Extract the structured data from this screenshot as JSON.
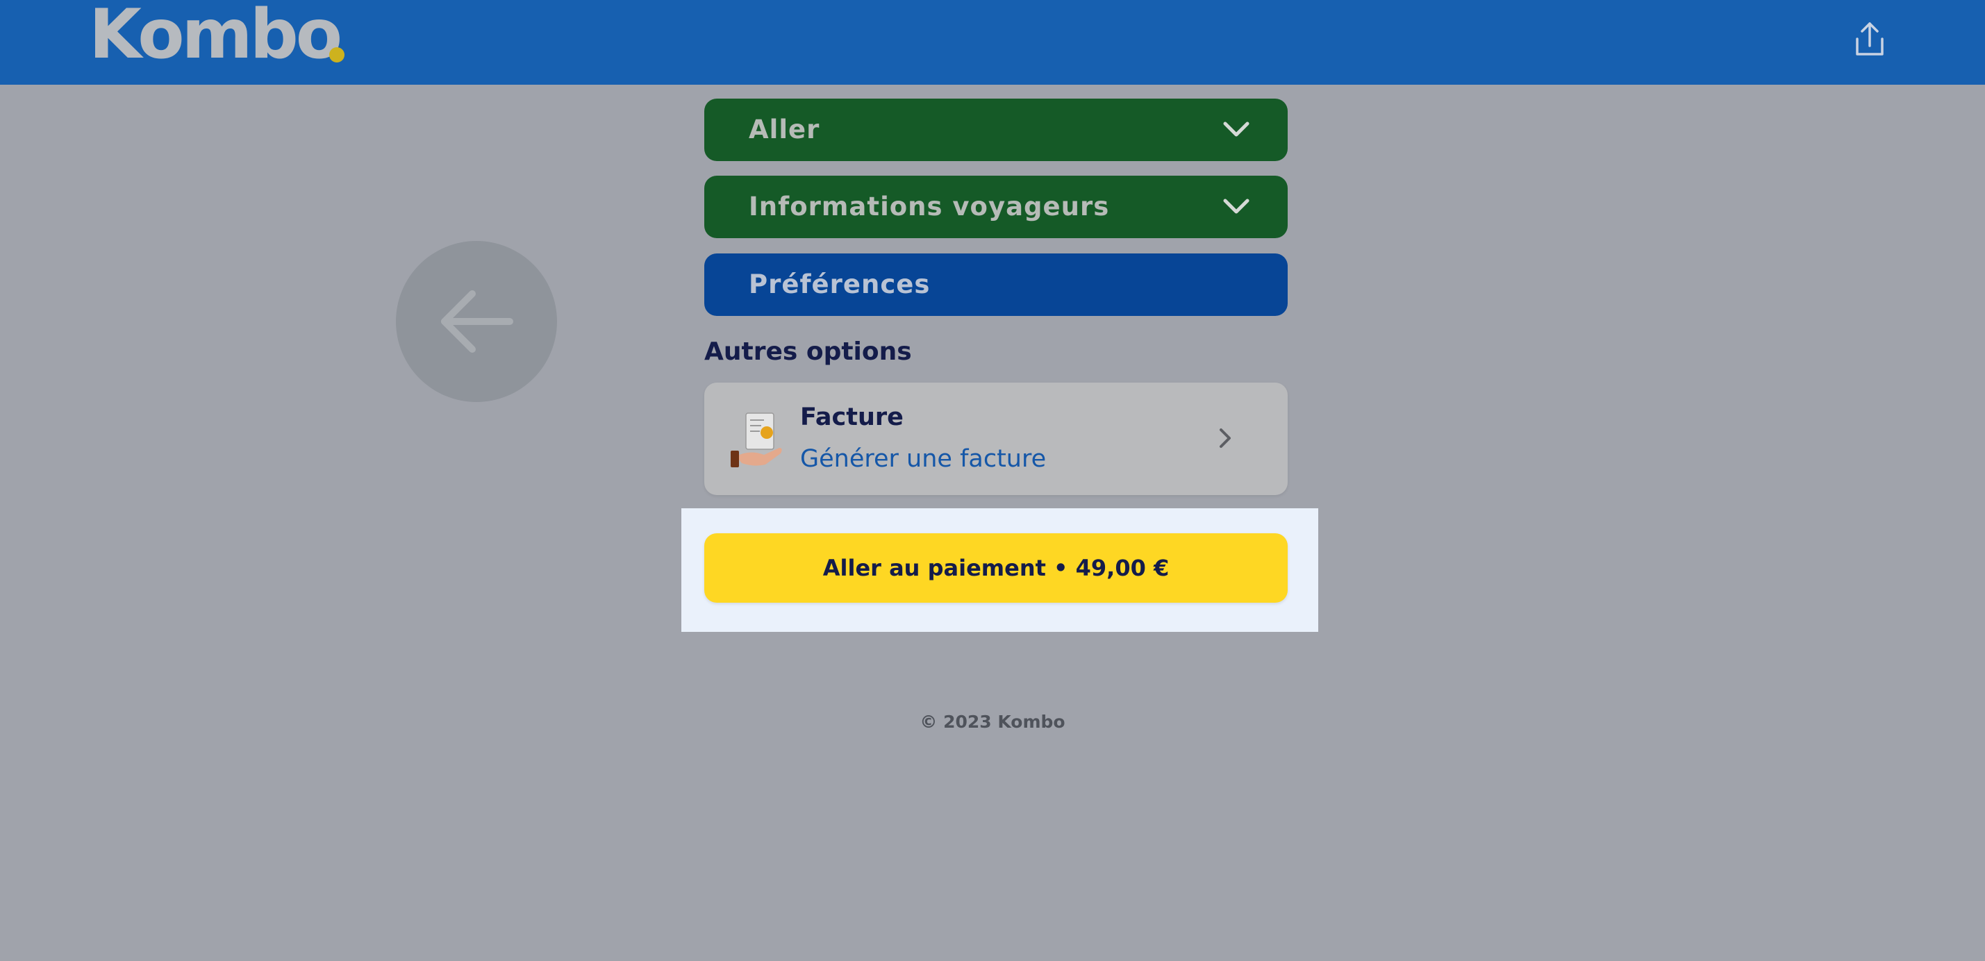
{
  "header": {
    "logo_text": "Kombo",
    "share_icon": "share-upload-icon",
    "background_color": "#1760b0"
  },
  "back_button": {
    "icon": "arrow-left-icon"
  },
  "sections": [
    {
      "label": "Aller",
      "icon": "chevron-down-icon",
      "color": "#155a27"
    },
    {
      "label": "Informations voyageurs",
      "icon": "chevron-down-icon",
      "color": "#155a27"
    },
    {
      "label": "Préférences",
      "color": "#074596"
    }
  ],
  "autres_options": {
    "heading": "Autres options",
    "facture": {
      "title": "Facture",
      "subtitle": "Générer une facture",
      "icon": "invoice-hand-icon",
      "chevron": "chevron-right-icon"
    }
  },
  "payment": {
    "label": "Aller au paiement • 49,00 €",
    "color": "#fed723"
  },
  "footer": {
    "copyright": "© 2023 Kombo"
  }
}
